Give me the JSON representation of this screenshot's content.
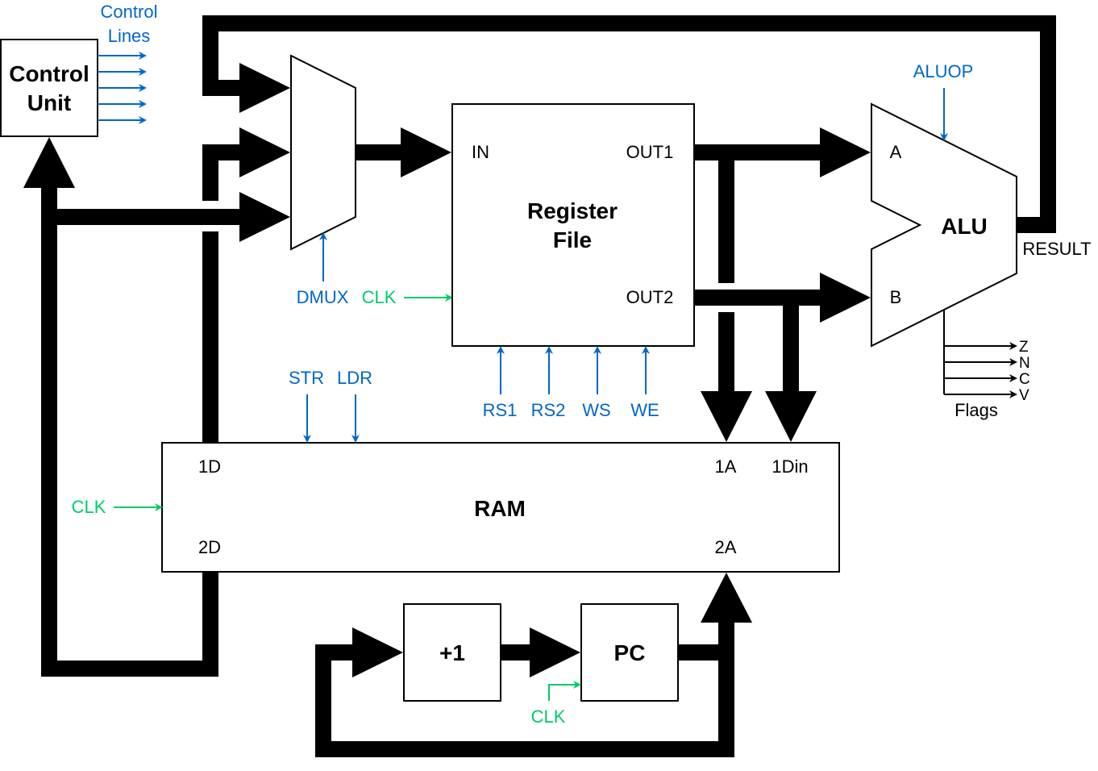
{
  "colors": {
    "control": "#0066CC",
    "clock": "#00CC66",
    "bus": "#000000"
  },
  "control_unit": {
    "line1": "Control",
    "line2": "Unit"
  },
  "control_lines": {
    "line1": "Control",
    "line2": "Lines"
  },
  "mux": {
    "select_label": "DMUX"
  },
  "register_file": {
    "line1": "Register",
    "line2": "File",
    "in": "IN",
    "out1": "OUT1",
    "out2": "OUT2",
    "clk": "CLK",
    "inputs": [
      "RS1",
      "RS2",
      "WS",
      "WE"
    ]
  },
  "alu": {
    "title": "ALU",
    "a": "A",
    "b": "B",
    "op": "ALUOP",
    "result": "RESULT",
    "flags_label": "Flags",
    "flags": [
      "Z",
      "N",
      "C",
      "V"
    ]
  },
  "ram": {
    "title": "RAM",
    "d1": "1D",
    "d2": "2D",
    "a1": "1A",
    "din1": "1Din",
    "a2": "2A",
    "clk": "CLK",
    "str": "STR",
    "ldr": "LDR"
  },
  "incrementer": {
    "title": "+1"
  },
  "pc": {
    "title": "PC",
    "clk": "CLK"
  }
}
